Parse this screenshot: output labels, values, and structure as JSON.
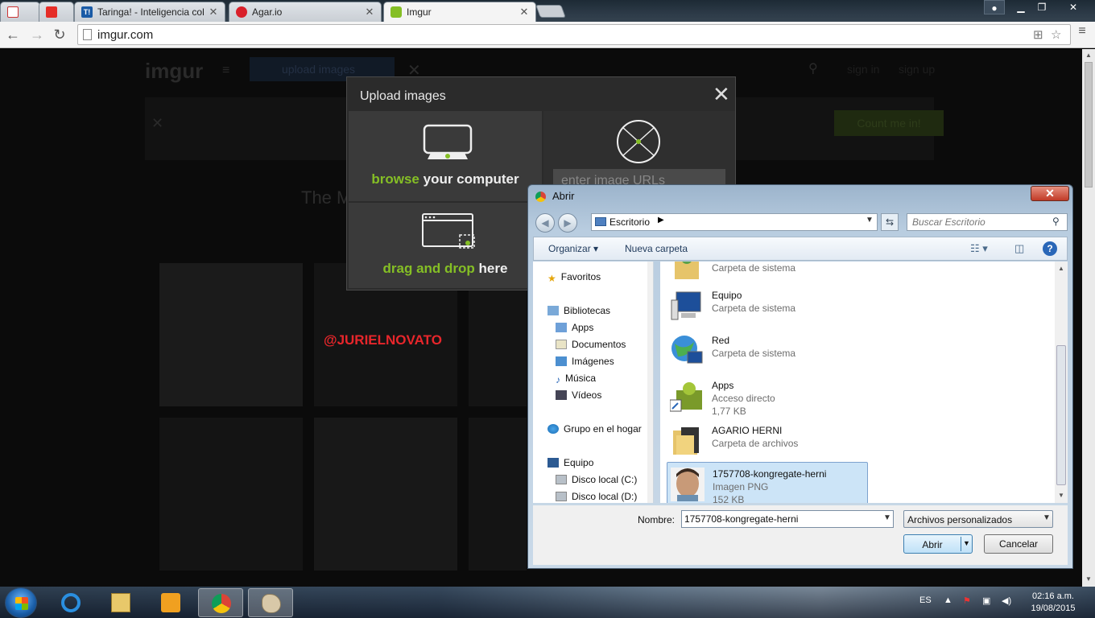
{
  "browser": {
    "tabs": [
      {
        "title": ""
      },
      {
        "title": ""
      },
      {
        "title": "Taringa! - Inteligencia col"
      },
      {
        "title": "Agar.io"
      },
      {
        "title": "Imgur"
      }
    ],
    "url": "imgur.com"
  },
  "imgur": {
    "logo": "imgur",
    "upload_button": "upload images",
    "sign_in": "sign in",
    "sign_up": "sign up",
    "count_me_in": "Count me in!",
    "headline": "The M"
  },
  "watermark": "@JURIELNOVATO",
  "upload_modal": {
    "title": "Upload images",
    "browse_green": "browse",
    "browse_rest": " your computer",
    "drag_green": "drag and drop",
    "drag_rest": " here",
    "url_placeholder": "enter image URLs"
  },
  "dialog": {
    "title": "Abrir",
    "location": "Escritorio",
    "search_placeholder": "Buscar Escritorio",
    "organize": "Organizar",
    "new_folder": "Nueva carpeta",
    "nav": {
      "favorites": "Favoritos",
      "libraries": "Bibliotecas",
      "apps": "Apps",
      "documents": "Documentos",
      "images": "Imágenes",
      "music": "Música",
      "videos": "Vídeos",
      "homegroup": "Grupo en el hogar",
      "computer": "Equipo",
      "disk_c": "Disco local (C:)",
      "disk_d": "Disco local (D:)"
    },
    "files": [
      {
        "name": "",
        "sub": "Carpeta de sistema",
        "size": ""
      },
      {
        "name": "Equipo",
        "sub": "Carpeta de sistema",
        "size": ""
      },
      {
        "name": "Red",
        "sub": "Carpeta de sistema",
        "size": ""
      },
      {
        "name": "Apps",
        "sub": "Acceso directo",
        "size": "1,77 KB"
      },
      {
        "name": "AGARIO HERNI",
        "sub": "Carpeta de archivos",
        "size": ""
      },
      {
        "name": "1757708-kongregate-herni",
        "sub": "Imagen PNG",
        "size": "152 KB"
      }
    ],
    "name_label": "Nombre:",
    "filename": "1757708-kongregate-herni",
    "filetype": "Archivos personalizados",
    "open_button": "Abrir",
    "cancel_button": "Cancelar"
  },
  "taskbar": {
    "lang": "ES",
    "time": "02:16 a.m.",
    "date": "19/08/2015"
  },
  "colors": {
    "imgur_green": "#85bf25",
    "watermark_red": "#e8262b",
    "selection": "#cce4f7"
  }
}
